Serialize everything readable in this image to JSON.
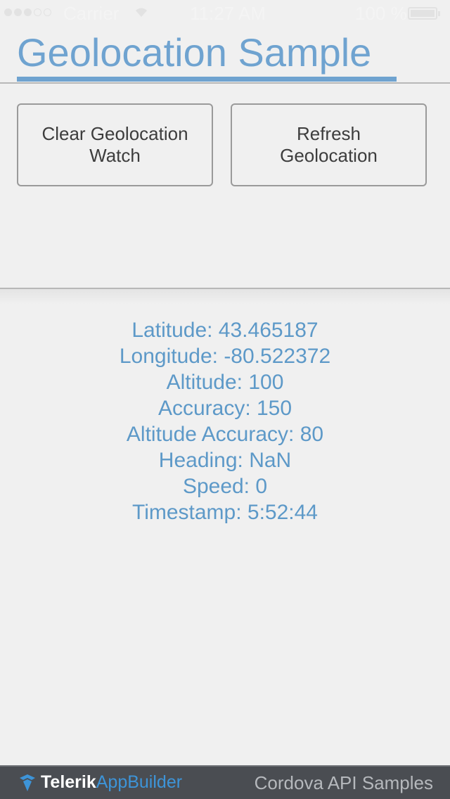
{
  "status_bar": {
    "carrier": "Carrier",
    "wifi_icon": "wifi-icon",
    "time": "11:27 AM",
    "battery": "100 %"
  },
  "header": {
    "title": "Geolocation Sample",
    "accent_color": "#6fa3d0"
  },
  "buttons": {
    "clear_label": "Clear Geolocation Watch",
    "refresh_label": "Refresh Geolocation"
  },
  "geolocation": {
    "latitude": "Latitude: 43.465187",
    "longitude": "Longitude: -80.522372",
    "altitude": "Altitude: 100",
    "accuracy": "Accuracy: 150",
    "altitude_accuracy": "Altitude Accuracy: 80",
    "heading": "Heading: NaN",
    "speed": "Speed: 0",
    "timestamp": "Timestamp: 5:52:44",
    "text_color": "#5d99c8"
  },
  "footer": {
    "brand_icon": "telerik-logo-icon",
    "brand_telerik": "Telerik",
    "brand_appbuilder": "AppBuilder",
    "caption": "Cordova API Samples",
    "background": "#4a4d52"
  }
}
